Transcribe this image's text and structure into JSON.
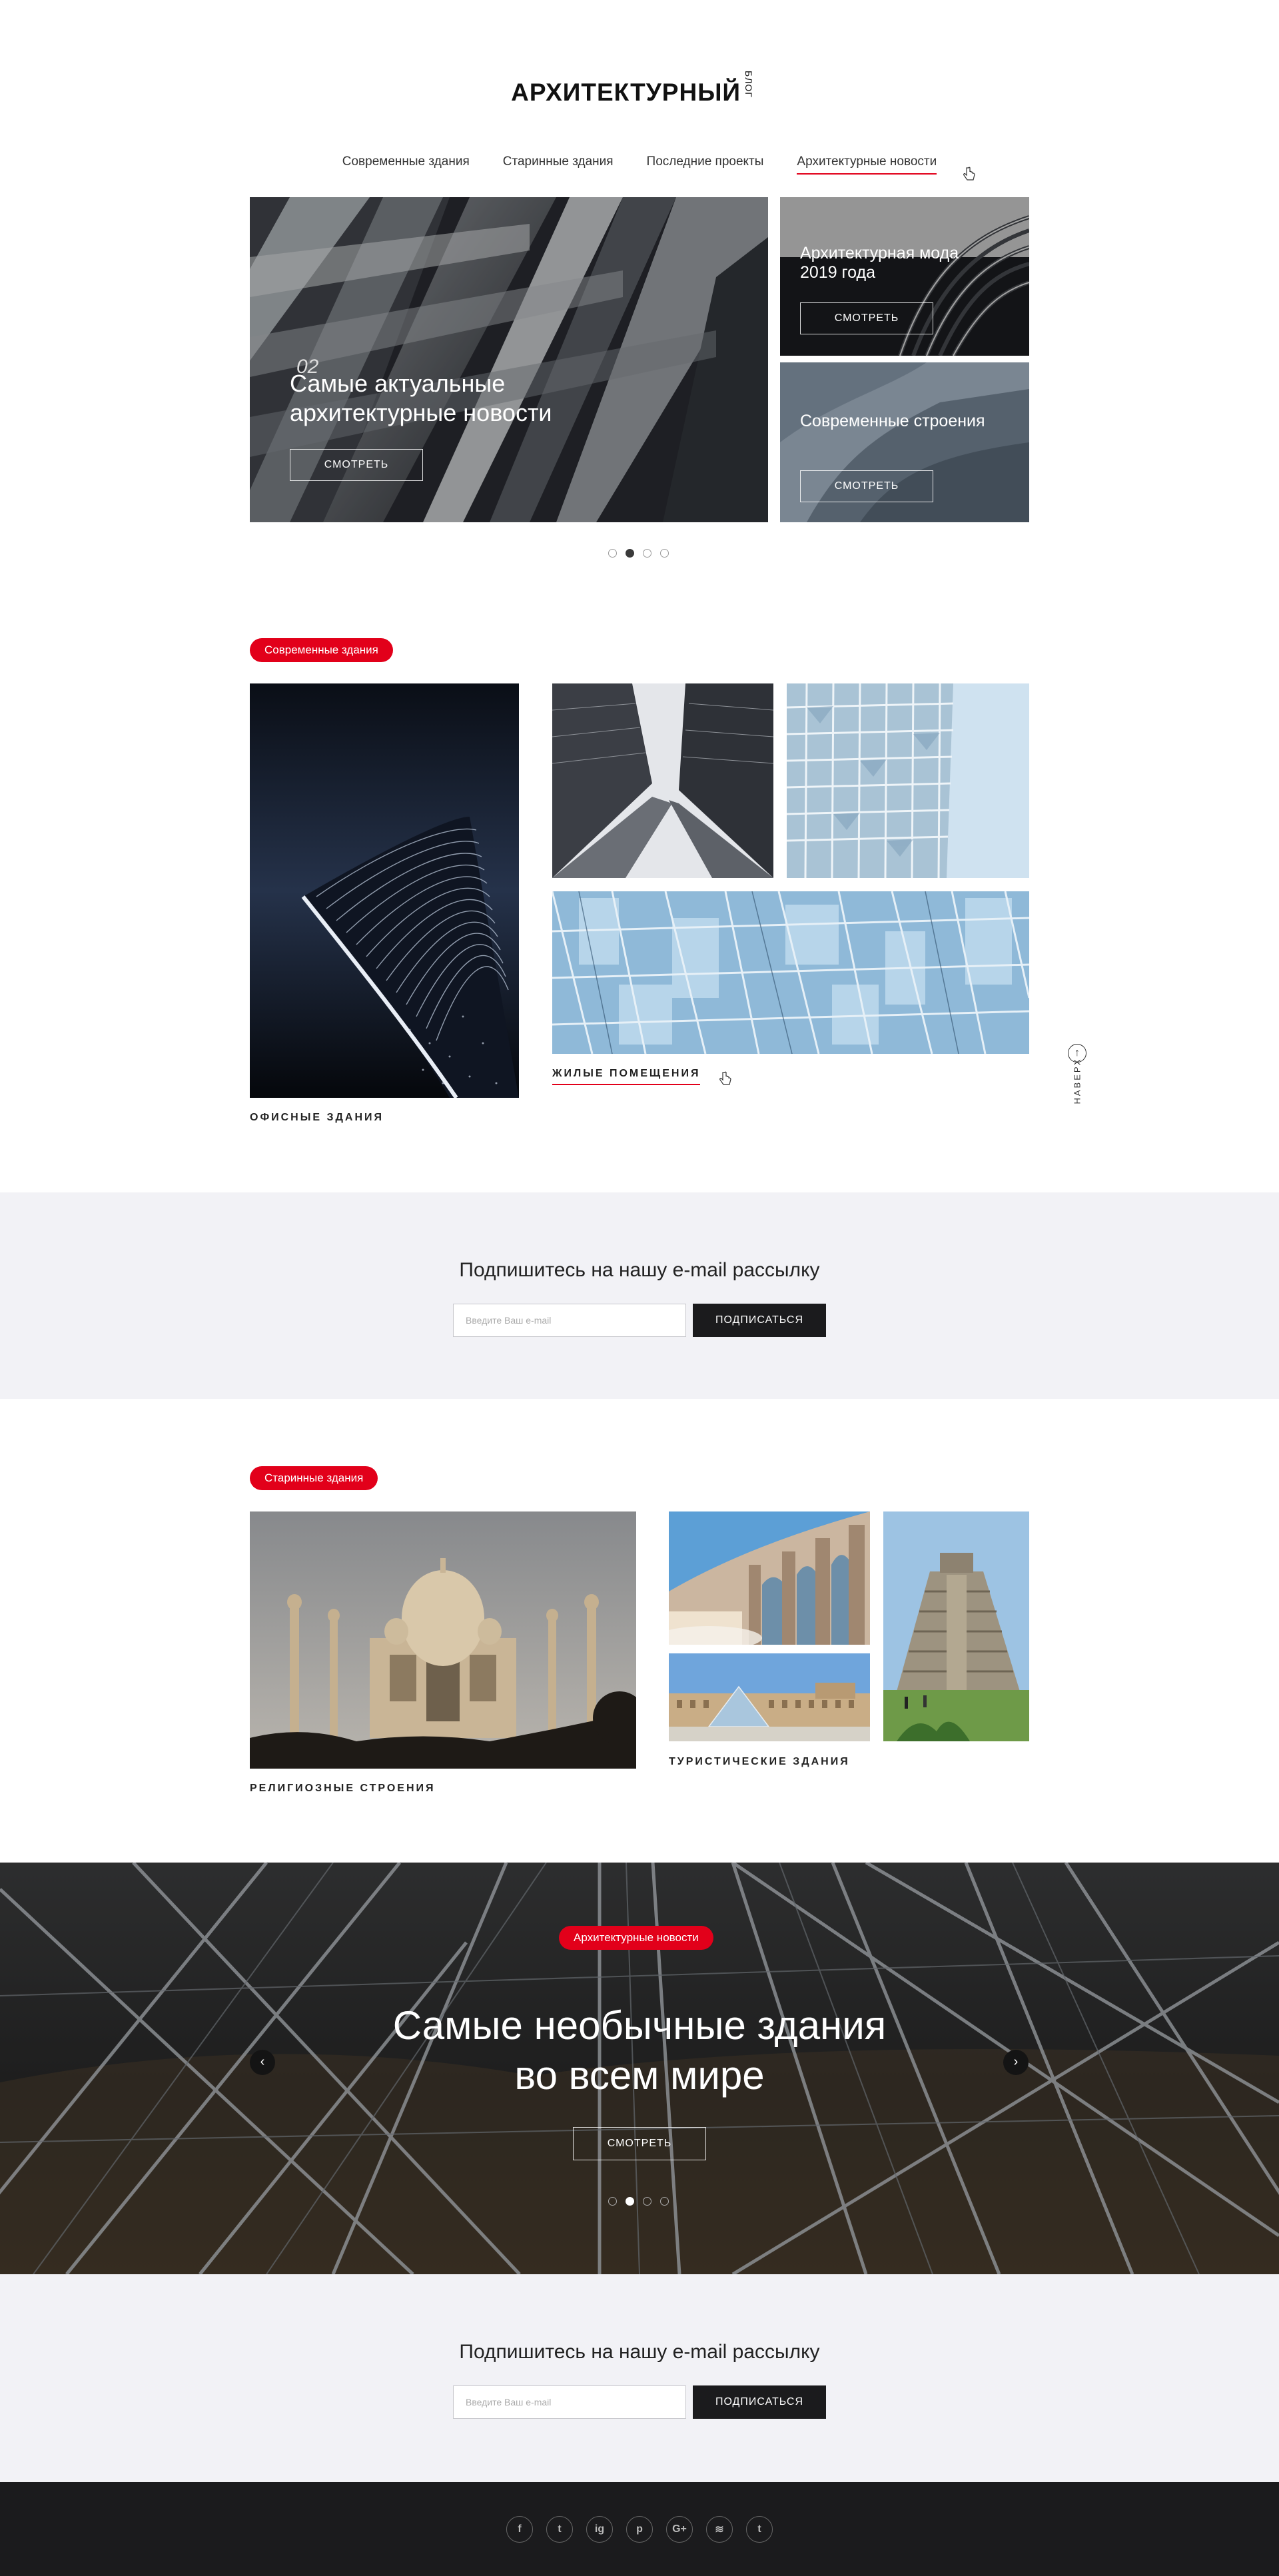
{
  "logo": {
    "title": "АРХИТЕКТУРНЫЙ",
    "sub": "БЛОГ"
  },
  "nav": [
    {
      "label": "Современные здания"
    },
    {
      "label": "Старинные здания"
    },
    {
      "label": "Последние проекты"
    },
    {
      "label": "Архитектурные новости",
      "active": true
    }
  ],
  "hero": {
    "number": "02",
    "title": "Самые актуальные архитектурные новости",
    "button": "СМОТРЕТЬ",
    "side": [
      {
        "title": "Архитектурная мода 2019 года",
        "button": "СМОТРЕТЬ"
      },
      {
        "title": "Современные строения",
        "button": "СМОТРЕТЬ"
      }
    ],
    "dots_total": 4,
    "dots_active": 2
  },
  "modern": {
    "badge": "Современные здания",
    "captions": {
      "office": "ОФИСНЫЕ ЗДАНИЯ",
      "residential": "ЖИЛЫЕ ПОМЕЩЕНИЯ"
    }
  },
  "to_top": "НАВЕРХ",
  "subscribe": {
    "title": "Подпишитесь на нашу e-mail рассылку",
    "placeholder": "Введите Ваш e-mail",
    "button": "ПОДПИСАТЬСЯ"
  },
  "ancient": {
    "badge": "Старинные здания",
    "captions": {
      "religious": "РЕЛИГИОЗНЫЕ СТРОЕНИЯ",
      "tourist": "ТУРИСТИЧЕСКИЕ ЗДАНИЯ"
    }
  },
  "banner": {
    "badge": "Архитектурные новости",
    "line1": "Самые необычные здания",
    "line2": "во всем мире",
    "button": "СМОТРЕТЬ",
    "prev": "‹",
    "next": "›",
    "dots_total": 4,
    "dots_active": 2
  },
  "social": [
    "f",
    "t",
    "ig",
    "p",
    "G+",
    "≋",
    "t"
  ],
  "social_icons": [
    "facebook-icon",
    "twitter-icon",
    "instagram-icon",
    "pinterest-icon",
    "google-plus-icon",
    "soundcloud-icon",
    "tumblr-icon"
  ],
  "colors": {
    "accent": "#e2001a",
    "dark": "#1b1b1d",
    "light_bg": "#f2f2f6"
  }
}
